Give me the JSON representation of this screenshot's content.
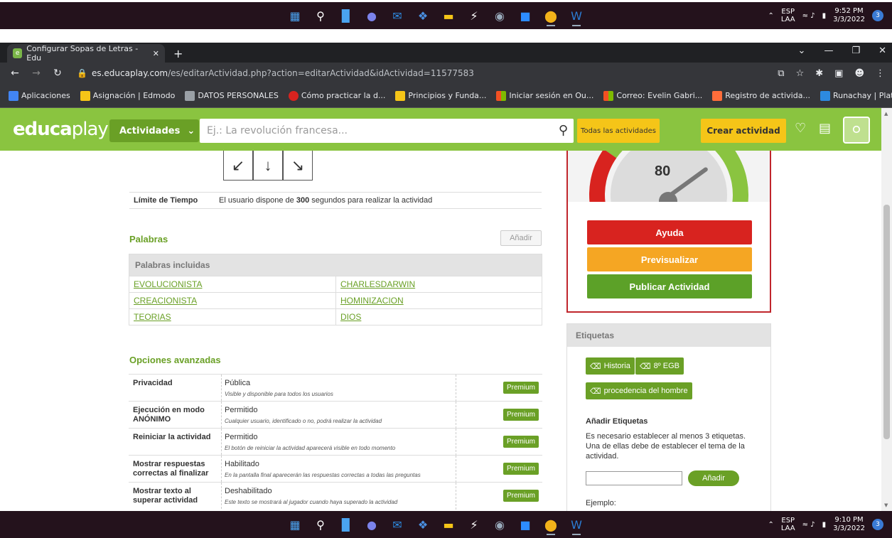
{
  "taskbar_top": {
    "lang": "ESP",
    "lang_sub": "LAA",
    "time": "9:52 PM",
    "date": "3/3/2022",
    "notifications": "3"
  },
  "taskbar_bottom": {
    "lang": "ESP",
    "lang_sub": "LAA",
    "time": "9:10 PM",
    "date": "3/3/2022",
    "notifications": "3"
  },
  "taskbar_icons": [
    "windows-icon",
    "search-icon",
    "file-explorer-icon",
    "teams-icon",
    "mail-icon",
    "dropbox-icon",
    "folder-icon",
    "power-automate-icon",
    "camera-icon",
    "zoom-icon",
    "chrome-icon",
    "word-icon"
  ],
  "browser": {
    "tab_title": "Configurar Sopas de Letras - Edu",
    "url_domain": "es.educaplay.com",
    "url_path": "/es/editarActividad.php?action=editarActividad&idActividad=11577583",
    "bookmarks": [
      "Aplicaciones",
      "Asignación | Edmodo",
      "DATOS PERSONALES",
      "Cómo practicar la d...",
      "Principios y Funda...",
      "Iniciar sesión en Ou...",
      "Correo: Evelin Gabri...",
      "Registro de activida...",
      "Runachay | Platafor..."
    ],
    "bookmarks_more": "»"
  },
  "header": {
    "logo_bold": "educa",
    "logo_light": "play",
    "activities_label": "Actividades",
    "search_placeholder": "Ej.: La revolución francesa...",
    "all_activities": "Todas las actividades",
    "create_activity": "Crear actividad"
  },
  "grid_arrows": [
    "↙",
    "↓",
    "↘"
  ],
  "time_limit": {
    "label": "Límite de Tiempo",
    "prefix": "El usuario dispone de ",
    "seconds": "300",
    "suffix": " segundos para realizar la actividad"
  },
  "words": {
    "title": "Palabras",
    "add_label": "Añadir",
    "header": "Palabras incluidas",
    "rows": [
      [
        "EVOLUCIONISTA",
        "CHARLESDARWIN"
      ],
      [
        "CREACIONISTA",
        "HOMINIZACION"
      ],
      [
        "TEORIAS",
        "DIOS"
      ]
    ]
  },
  "advanced": {
    "title": "Opciones avanzadas",
    "premium_label": "Premium",
    "rows": [
      {
        "key": "Privacidad",
        "value": "Pública",
        "desc": "Visible y disponible para todos los usuarios"
      },
      {
        "key": "Ejecución en modo ANÓNIMO",
        "value": "Permitido",
        "desc": "Cualquier usuario, identificado o no, podrá realizar la actividad"
      },
      {
        "key": "Reiniciar la actividad",
        "value": "Permitido",
        "desc": "El botón de reiniciar la actividad aparecerá visible en todo momento"
      },
      {
        "key": "Mostrar respuestas correctas al finalizar",
        "value": "Habilitado",
        "desc": "En la pantalla final aparecerán las respuestas correctas a todas las preguntas"
      },
      {
        "key": "Mostrar texto al superar actividad",
        "value": "Deshabilitado",
        "desc": "Este texto se mostrará al jugador cuando haya superado la actividad"
      }
    ]
  },
  "publish": {
    "score": "80",
    "help": "Ayuda",
    "preview": "Previsualizar",
    "publish": "Publicar Actividad",
    "help_color": "#d8231f",
    "preview_color": "#f5a623",
    "publish_color": "#6aa026"
  },
  "tags": {
    "title": "Etiquetas",
    "items": [
      "Historia",
      "8º EGB",
      "procedencia del hombre"
    ],
    "add_title": "Añadir Etiquetas",
    "hint": "Es necesario establecer al menos 3 etiquetas. Una de ellas debe de establecer el tema de la actividad.",
    "add_button": "Añadir",
    "example_label": "Ejemplo:"
  }
}
